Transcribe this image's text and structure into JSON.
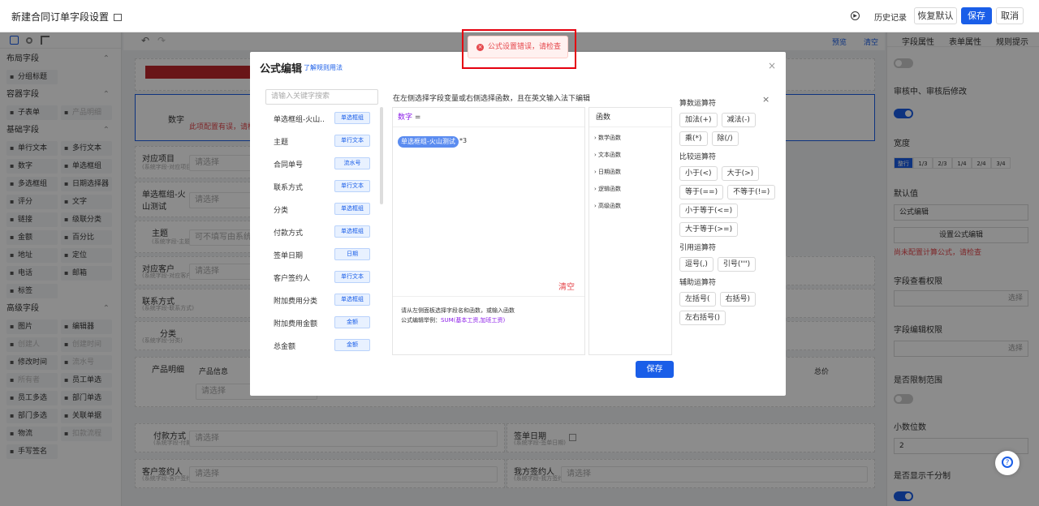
{
  "header": {
    "title": "新建合同订单字段设置",
    "history": "历史记录",
    "reset": "恢复默认",
    "save": "保存",
    "cancel": "取消"
  },
  "left_panel": {
    "sections": [
      {
        "title": "布局字段",
        "items": [
          {
            "label": "分组标题",
            "icon": "layout-icon"
          }
        ]
      },
      {
        "title": "容器字段",
        "items": [
          {
            "label": "子表单",
            "icon": "subform-icon"
          },
          {
            "label": "产品明细",
            "icon": "product-icon",
            "disabled": true
          }
        ]
      },
      {
        "title": "基础字段",
        "items": [
          {
            "label": "单行文本"
          },
          {
            "label": "多行文本"
          },
          {
            "label": "数字"
          },
          {
            "label": "单选框组"
          },
          {
            "label": "多选框组"
          },
          {
            "label": "日期选择器"
          },
          {
            "label": "评分"
          },
          {
            "label": "文字"
          },
          {
            "label": "链接"
          },
          {
            "label": "级联分类"
          },
          {
            "label": "金额"
          },
          {
            "label": "百分比"
          },
          {
            "label": "地址"
          },
          {
            "label": "定位"
          },
          {
            "label": "电话"
          },
          {
            "label": "邮箱"
          },
          {
            "label": "标签"
          }
        ]
      },
      {
        "title": "高级字段",
        "items": [
          {
            "label": "图片"
          },
          {
            "label": "编辑器"
          },
          {
            "label": "创建人",
            "disabled": true
          },
          {
            "label": "创建时间",
            "disabled": true
          },
          {
            "label": "修改时间"
          },
          {
            "label": "流水号",
            "disabled": true
          },
          {
            "label": "所有者",
            "disabled": true
          },
          {
            "label": "员工单选"
          },
          {
            "label": "员工多选"
          },
          {
            "label": "部门单选"
          },
          {
            "label": "部门多选"
          },
          {
            "label": "关联单据"
          },
          {
            "label": "物流"
          },
          {
            "label": "扣款流程",
            "disabled": true
          },
          {
            "label": "手写签名"
          }
        ]
      }
    ]
  },
  "canvas": {
    "preview": "预览",
    "clear": "清空",
    "rows": [
      {
        "label": "数字",
        "error": "此项配置有误，请检查"
      },
      {
        "label": "对应项目",
        "sub": "(系统字段-对应项目)",
        "placeholder": "请选择"
      },
      {
        "label": "单选框组-火山测试",
        "placeholder": "请选择"
      },
      {
        "label": "主题",
        "sub": "(系统字段-主题)",
        "placeholder": "可不填写由系统生成"
      },
      {
        "label": "对应客户",
        "sub": "(系统字段-对应客户)",
        "placeholder": "请选择"
      },
      {
        "label": "联系方式",
        "sub": "(系统字段-联系方式)"
      },
      {
        "label": "分类",
        "sub": "(系统字段-分类)"
      },
      {
        "label": "产品明细",
        "col1": "产品信息",
        "col2": "总价",
        "placeholder": "请选择"
      },
      {
        "label": "付款方式",
        "sub": "(系统字段-付款方式)",
        "placeholder": "请选择"
      },
      {
        "label": "签单日期",
        "sub": "(系统字段-签单日期)"
      },
      {
        "label": "客户签约人",
        "sub": "(系统字段-客户签约人)",
        "placeholder": "请选择"
      },
      {
        "label": "我方签约人",
        "sub": "(系统字段-我方签约人)",
        "placeholder": "请选择"
      }
    ]
  },
  "right_panel": {
    "tabs": [
      "字段属性",
      "表单属性",
      "规则提示"
    ],
    "review_label": "审核中、审核后修改",
    "width_label": "宽度",
    "widths": [
      "整行",
      "1/3",
      "2/3",
      "1/4",
      "2/4",
      "3/4"
    ],
    "default_label": "默认值",
    "default_value": "公式编辑",
    "formula_button": "设置公式编辑",
    "formula_error": "尚未配置计算公式，请检查",
    "view_perm": "字段查看权限",
    "edit_perm": "字段编辑权限",
    "select": "选择",
    "limit_label": "是否限制范围",
    "decimal_label": "小数位数",
    "decimal_value": "2",
    "thousand_label": "是否显示千分制"
  },
  "dialog": {
    "title": "公式编辑",
    "help_link": "了解规则用法",
    "search_placeholder": "请输入关键字搜索",
    "fields": [
      {
        "name": "单选框组-火山...",
        "type": "单选框组"
      },
      {
        "name": "主题",
        "type": "单行文本"
      },
      {
        "name": "合同单号",
        "type": "流水号"
      },
      {
        "name": "联系方式",
        "type": "单行文本"
      },
      {
        "name": "分类",
        "type": "单选框组"
      },
      {
        "name": "付款方式",
        "type": "单选框组"
      },
      {
        "name": "签单日期",
        "type": "日期"
      },
      {
        "name": "客户签约人",
        "type": "单行文本"
      },
      {
        "name": "附加费用分类",
        "type": "单选框组"
      },
      {
        "name": "附加费用金额",
        "type": "金额"
      },
      {
        "name": "总金额",
        "type": "金额"
      }
    ],
    "hint": "在左侧选择字段变量或右侧选择函数，且在英文输入法下编辑",
    "editor_var": "数字",
    "editor_eq": "=",
    "chip": "单选框组-火山测试",
    "operator": "*3",
    "clear": "清空",
    "tip1": "请从左侧面板选择字段名和函数，或输入函数",
    "tip2_prefix": "公式编辑举例：",
    "tip2_example": "SUM(基本工资,加班工资)",
    "functions_title": "函数",
    "function_groups": [
      "数学函数",
      "文本函数",
      "日期函数",
      "逻辑函数",
      "高级函数"
    ],
    "operator_sections": [
      {
        "title": "算数运算符",
        "buttons": [
          "加法(+)",
          "减法(-)",
          "乘(*)",
          "除(/)"
        ]
      },
      {
        "title": "比较运算符",
        "buttons": [
          "小于(<)",
          "大于(>)",
          "等于(==)",
          "不等于(!=)",
          "小于等于(<=)",
          "大于等于(>=)"
        ]
      },
      {
        "title": "引用运算符",
        "buttons": [
          "逗号(,)",
          "引号(\"\")"
        ]
      },
      {
        "title": "辅助运算符",
        "buttons": [
          "左括号(",
          "右括号)",
          "左右括号()"
        ]
      }
    ],
    "save": "保存"
  },
  "toast": {
    "message": "公式设置错误，请检查"
  },
  "colors": {
    "primary": "#1a5ee8",
    "error": "#e5484d"
  }
}
